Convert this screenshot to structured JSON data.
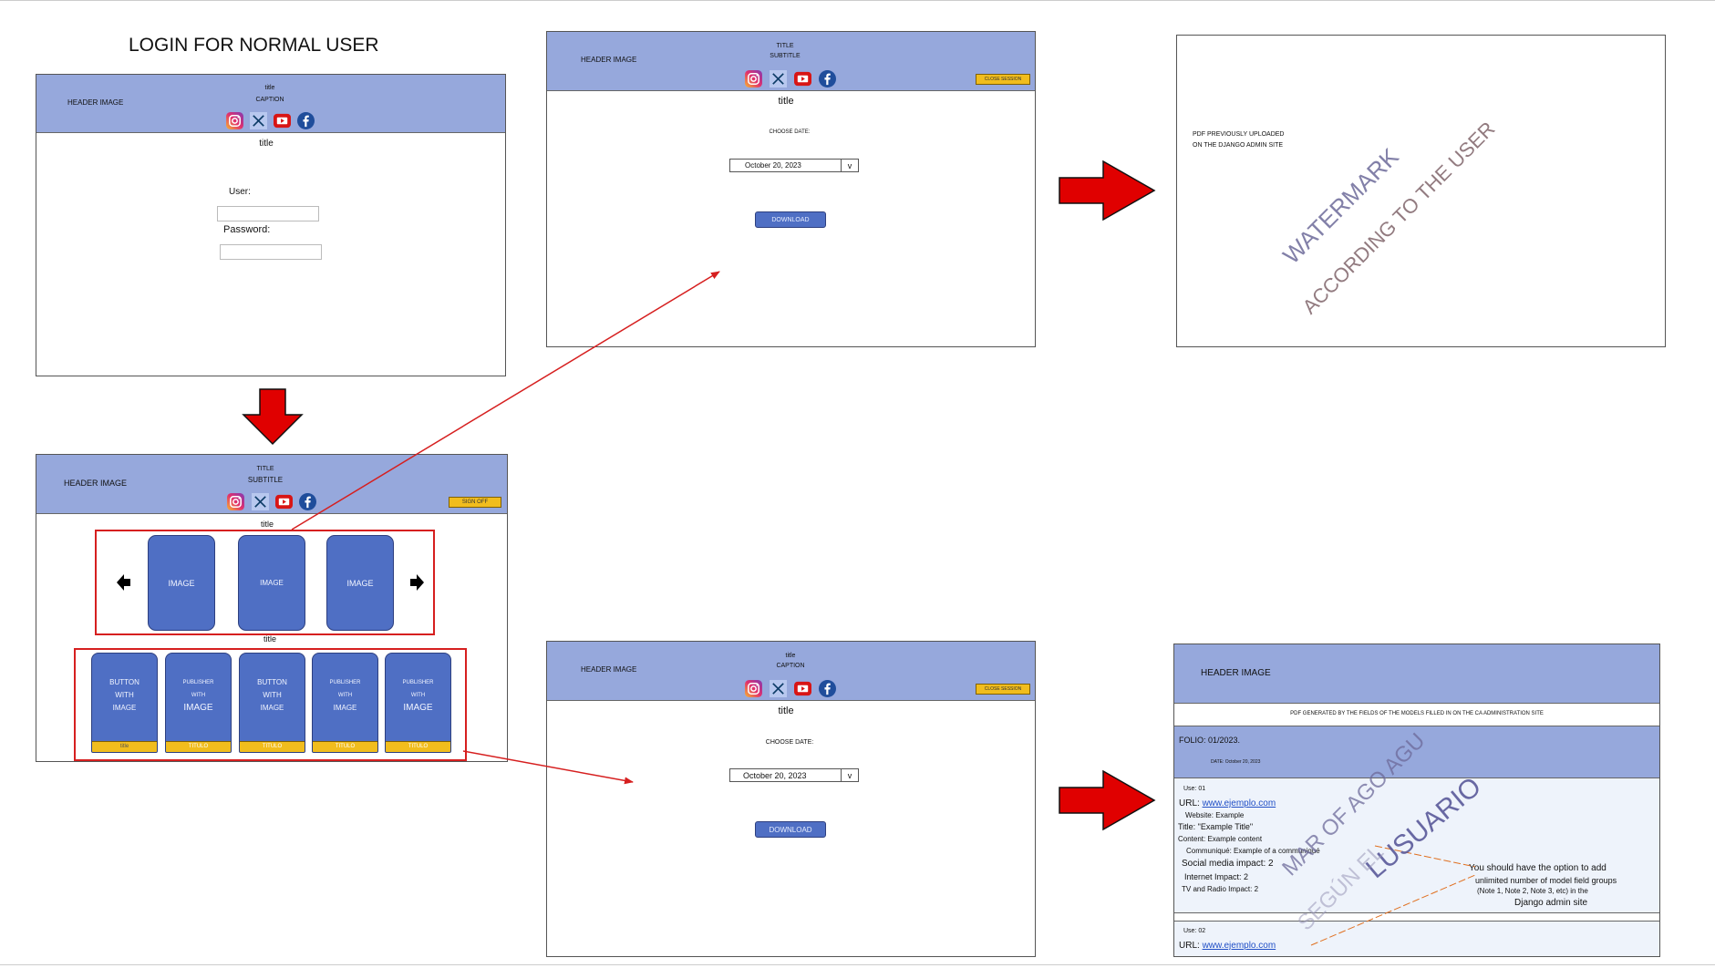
{
  "login": {
    "heading": "LOGIN FOR NORMAL USER",
    "header_image": "HEADER IMAGE",
    "title_small": "title",
    "caption": "CAPTION",
    "title": "title",
    "user_label": "User:",
    "password_label": "Password:"
  },
  "home": {
    "header_image": "HEADER IMAGE",
    "title": "TITLE",
    "subtitle": "SUBTITLE",
    "sign_off": "SIGN OFF",
    "carousel_title": "title",
    "images": [
      "IMAGE",
      "IMAGE",
      "IMAGE"
    ],
    "publishers_title": "title",
    "cards": [
      {
        "lines": [
          "BUTTON",
          "WITH",
          "IMAGE"
        ],
        "bar": "title"
      },
      {
        "lines": [
          "PUBLISHER",
          "WITH",
          "IMAGE"
        ],
        "bar": "TITULO"
      },
      {
        "lines": [
          "BUTTON",
          "WITH",
          "IMAGE"
        ],
        "bar": "TITULO"
      },
      {
        "lines": [
          "PUBLISHER",
          "WITH",
          "IMAGE"
        ],
        "bar": "TITULO"
      },
      {
        "lines": [
          "PUBLISHER",
          "WITH",
          "IMAGE"
        ],
        "bar": "TITULO"
      }
    ]
  },
  "download_top": {
    "header_image": "HEADER IMAGE",
    "title": "TITLE",
    "subtitle": "SUBTITLE",
    "close_session": "CLOSE SESSION",
    "page_title": "title",
    "choose_date": "CHOOSE DATE:",
    "date": "October 20, 2023",
    "dropdown_arrow": "v",
    "download": "DOWNLOAD"
  },
  "download_bottom": {
    "header_image": "HEADER IMAGE",
    "title": "title",
    "caption": "CAPTION",
    "close_session": "CLOSE SESSION",
    "page_title": "title",
    "choose_date": "CHOOSE DATE:",
    "date": "October 20, 2023",
    "dropdown_arrow": "v",
    "download": "DOWNLOAD"
  },
  "pdf_top": {
    "line1": "PDF PREVIOUSLY UPLOADED",
    "line2": "ON THE DJANGO ADMIN SITE",
    "watermark1": "WATERMARK",
    "watermark2": "ACCORDING TO THE USER"
  },
  "pdf_bottom": {
    "header_image": "HEADER IMAGE",
    "generated_note": "PDF GENERATED BY THE FIELDS OF THE MODELS FILLED IN ON THE CA ADMINISTRATION SITE",
    "folio": "FOLIO: 01/2023.",
    "date": "DATE: October 20, 2023",
    "use1": "Use: 01",
    "url_label": "URL:",
    "url": "www.ejemplo.com",
    "website": "Website: Example",
    "title_line": "Title: \"Example Title\"",
    "content": "Content: Example content",
    "communique": "Communiqué: Example of a communiqué",
    "social": "Social media impact: 2",
    "internet": "Internet Impact: 2",
    "tv": "TV and Radio Impact: 2",
    "note1": "You should have the option to add",
    "note2": "unlimited number of model field groups",
    "note3": "(Note 1, Note 2, Note 3, etc) in the",
    "note4": "Django admin site",
    "watermark1": "MAR OF AGO AGU",
    "watermark2": "LUSUARIO",
    "watermark3": "SEGÚN EL",
    "use2": "Use: 02",
    "url2": "www.ejemplo.com"
  },
  "colors": {
    "header": "#96a8dc",
    "button_blue": "#4f6fc4",
    "yellow": "#f1bd1d",
    "red": "#d61f1f",
    "watermark_purple": "#6d6a9a"
  },
  "icons": [
    "instagram-icon",
    "x-icon",
    "youtube-icon",
    "facebook-icon",
    "arrow-left-icon",
    "arrow-right-icon"
  ]
}
